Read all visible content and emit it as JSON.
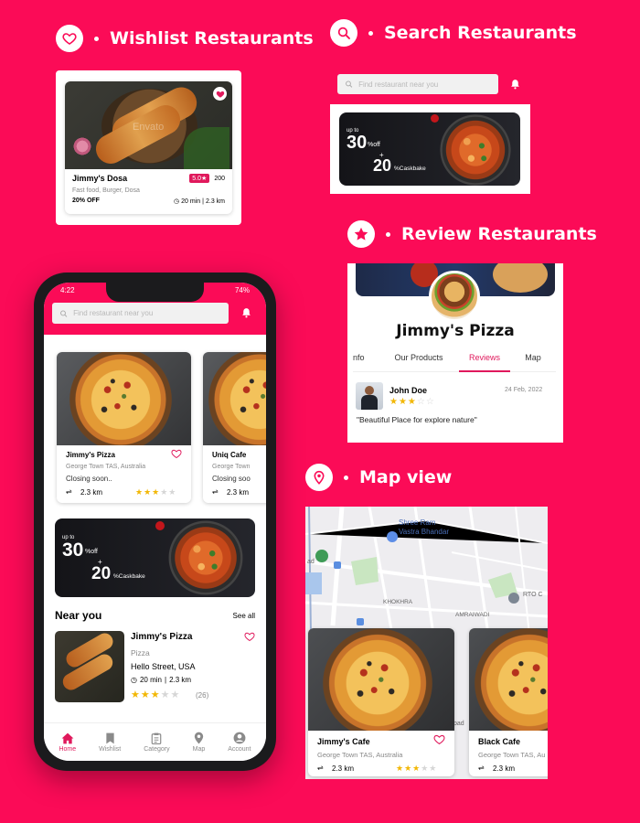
{
  "colors": {
    "brand": "#fb0b57",
    "accent": "#e0195c",
    "star": "#f2b705"
  },
  "sections": {
    "wishlist": {
      "title": "Wishlist Restaurants",
      "icon": "heart-icon"
    },
    "search": {
      "title": "Search Restaurants",
      "icon": "search-icon"
    },
    "review": {
      "title": "Review Restaurants",
      "icon": "star-icon"
    },
    "map": {
      "title": "Map view",
      "icon": "location-pin-icon"
    }
  },
  "wishlist_card": {
    "name": "Jimmy's Dosa",
    "rating": "5.0★",
    "count": "200",
    "tags": "Fast food, Burger, Dosa",
    "offer": "20% OFF",
    "time": "20 min",
    "distance": "2.3 km",
    "watermark": "Envato"
  },
  "search_preview": {
    "placeholder": "Find restaurant near you"
  },
  "banner": {
    "upto": "up to",
    "percent": "30",
    "off": "%off",
    "plus": "+",
    "cashback_num": "20",
    "cashback": "%Caskbake"
  },
  "review_preview": {
    "restaurant": "Jimmy's Pizza",
    "tabs": [
      "nfo",
      "Our Products",
      "Reviews",
      "Map"
    ],
    "active_tab": "Reviews",
    "reviewer": "John Doe",
    "date": "24 Feb, 2022",
    "rating": 3,
    "comment": "\"Beautiful Place for explore nature\""
  },
  "map_preview": {
    "labels": {
      "place": "Shree Ram",
      "place2": "Vastra Bhandar",
      "khokhra": "KHOKHRA",
      "amraiwadi": "AMRAIWADI",
      "rto": "RTO C",
      "pad": "pad",
      "ad": "ad"
    },
    "cards": [
      {
        "name": "Jimmy's Cafe",
        "address": "George Town TAS, Australia",
        "distance": "2.3 km",
        "rating": 3
      },
      {
        "name": "Black Cafe",
        "address": "George Town TAS, Au",
        "distance": "2.3 km"
      }
    ]
  },
  "phone": {
    "status": {
      "time": "4:22",
      "battery": "74%"
    },
    "search_placeholder": "Find restaurant near you",
    "cards": [
      {
        "name": "Jimmy's Pizza",
        "address": "George Town TAS, Australia",
        "status": "Closing soon..",
        "distance": "2.3 km",
        "rating": 3
      },
      {
        "name": "Uniq Cafe",
        "address": "George Town",
        "status": "Closing soo",
        "distance": "2.3 km"
      }
    ],
    "near_you": {
      "title": "Near you",
      "see_all": "See all",
      "item": {
        "name": "Jimmy's Pizza",
        "category": "Pizza",
        "address": "Hello Street, USA",
        "time": "20 min",
        "distance": "2.3 km",
        "rating": 3,
        "reviews": "(26)"
      }
    },
    "nav": [
      {
        "label": "Home",
        "icon": "home-icon",
        "active": true
      },
      {
        "label": "Wishlist",
        "icon": "bookmark-icon"
      },
      {
        "label": "Category",
        "icon": "clipboard-icon"
      },
      {
        "label": "Map",
        "icon": "map-pin-icon"
      },
      {
        "label": "Account",
        "icon": "account-icon"
      }
    ]
  }
}
